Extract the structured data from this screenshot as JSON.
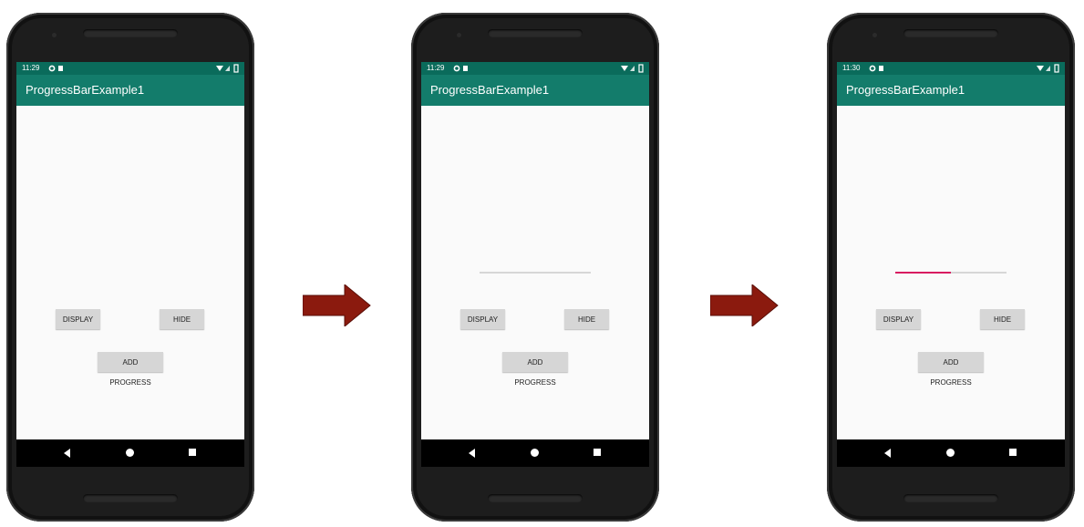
{
  "phones": [
    {
      "status_time": "11:29",
      "app_title": "ProgressBarExample1",
      "display_label": "DISPLAY",
      "hide_label": "HIDE",
      "add_progress_label": "ADD PROGRESS",
      "progress_visible": false,
      "progress_fraction": 0
    },
    {
      "status_time": "11:29",
      "app_title": "ProgressBarExample1",
      "display_label": "DISPLAY",
      "hide_label": "HIDE",
      "add_progress_label": "ADD PROGRESS",
      "progress_visible": true,
      "progress_fraction": 0
    },
    {
      "status_time": "11:30",
      "app_title": "ProgressBarExample1",
      "display_label": "DISPLAY",
      "hide_label": "HIDE",
      "add_progress_label": "ADD PROGRESS",
      "progress_visible": true,
      "progress_fraction": 0.5
    }
  ],
  "icons": {
    "status_left": [
      "settings-icon",
      "sd-card-icon"
    ],
    "status_right": [
      "wifi-icon",
      "signal-icon",
      "battery-icon"
    ],
    "nav": [
      "back-icon",
      "home-icon",
      "recents-icon"
    ],
    "between_phones": "right-arrow-icon"
  },
  "colors": {
    "status_bar": "#0a6b5b",
    "app_bar": "#137c6b",
    "progress_fill": "#d81b60",
    "progress_track": "#d6d6d6",
    "arrow": "#8b1a0e"
  }
}
